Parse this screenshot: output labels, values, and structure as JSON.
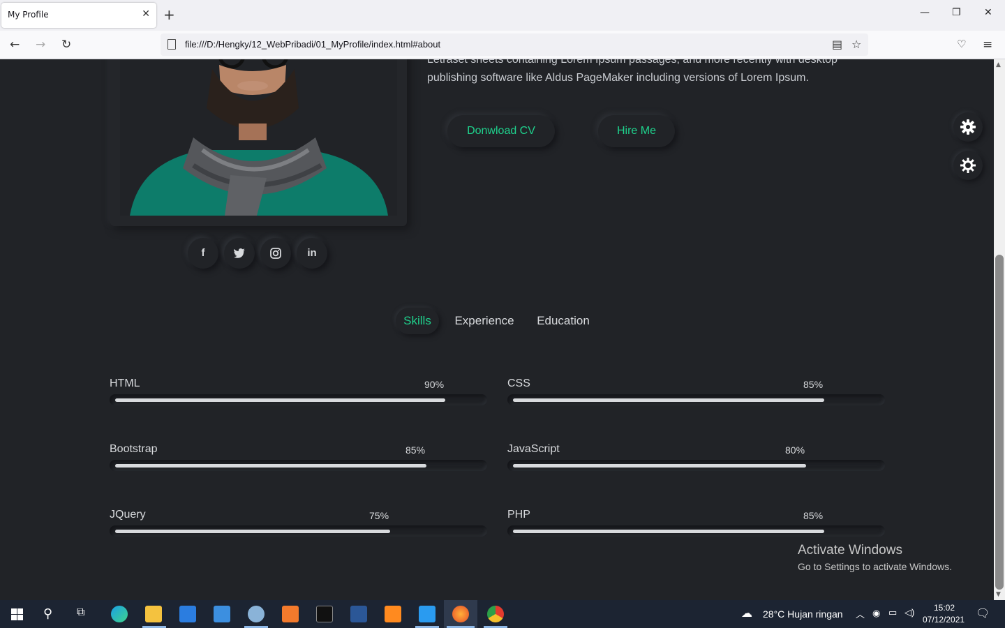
{
  "browser": {
    "tab_title": "My Profile",
    "url": "file:///D:/Hengky/12_WebPribadi/01_MyProfile/index.html#about"
  },
  "about": {
    "line1": "Letraset sheets containing Lorem Ipsum passages, and more recently with desktop",
    "line2": "publishing software like Aldus PageMaker including versions of Lorem Ipsum.",
    "download_cv": "Donwload CV",
    "hire_me": "Hire Me"
  },
  "social": [
    "f",
    "twitter",
    "instagram",
    "in"
  ],
  "tabs": {
    "skills": "Skills",
    "experience": "Experience",
    "education": "Education",
    "active": "Skills"
  },
  "skills": [
    {
      "name": "HTML",
      "percent_label": "90%",
      "value": 90
    },
    {
      "name": "CSS",
      "percent_label": "85%",
      "value": 85
    },
    {
      "name": "Bootstrap",
      "percent_label": "85%",
      "value": 85
    },
    {
      "name": "JavaScript",
      "percent_label": "80%",
      "value": 80
    },
    {
      "name": "JQuery",
      "percent_label": "75%",
      "value": 75
    },
    {
      "name": "PHP",
      "percent_label": "85%",
      "value": 85
    }
  ],
  "watermark": {
    "title": "Activate Windows",
    "subtitle": "Go to Settings to activate Windows."
  },
  "taskbar": {
    "weather": "28°C  Hujan ringan",
    "time": "15:02",
    "date": "07/12/2021"
  },
  "colors": {
    "accent": "#1fd28d",
    "background": "#212327"
  }
}
